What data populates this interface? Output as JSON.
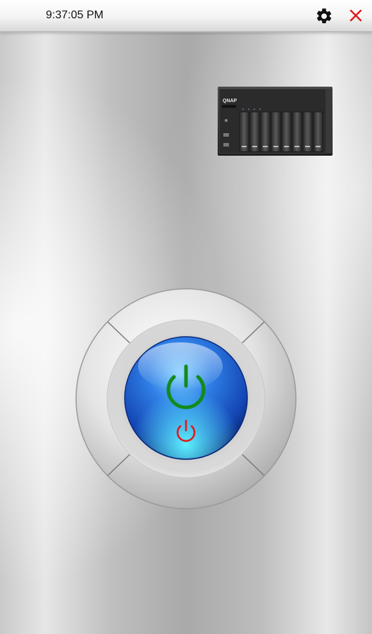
{
  "status_bar": {
    "time": "9:37:05 PM"
  },
  "toolbar": {
    "settings_icon": "gear-icon",
    "close_icon": "close-icon",
    "close_color": "#e0191d"
  },
  "device": {
    "brand": "QNAP",
    "drive_bays": 8
  },
  "power_button": {
    "power_on_icon": "power-icon",
    "power_on_color": "#1a8a1a",
    "power_off_icon": "power-icon",
    "power_off_color": "#e0191d"
  }
}
